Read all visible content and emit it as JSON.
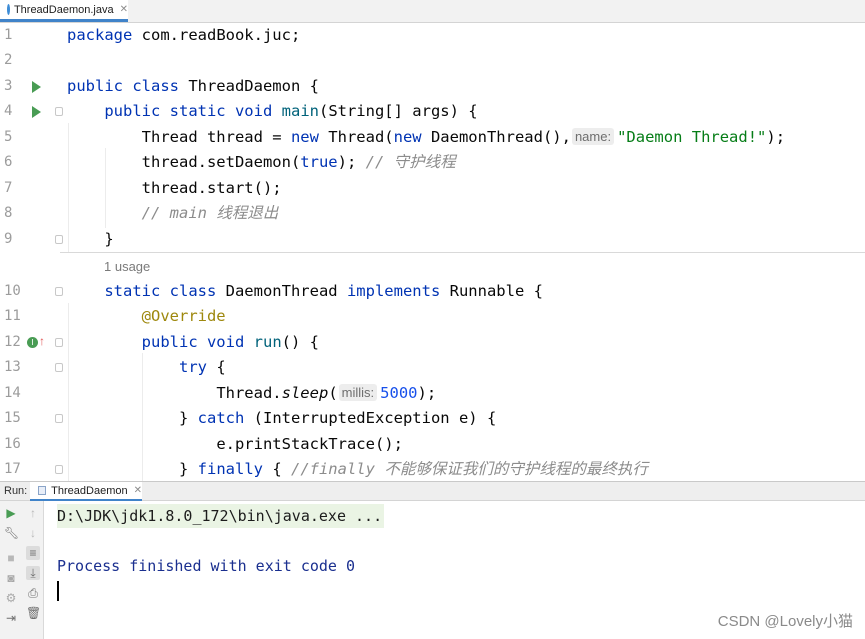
{
  "editor": {
    "tab": {
      "label": "ThreadDaemon.java",
      "close_icon": "close-icon",
      "file_icon": "java-class-icon"
    },
    "lines": [
      {
        "num": "1"
      },
      {
        "num": "2"
      },
      {
        "num": "3"
      },
      {
        "num": "4"
      },
      {
        "num": "5"
      },
      {
        "num": "6"
      },
      {
        "num": "7"
      },
      {
        "num": "8"
      },
      {
        "num": "9"
      },
      {
        "num": "10"
      },
      {
        "num": "11"
      },
      {
        "num": "12"
      },
      {
        "num": "13"
      },
      {
        "num": "14"
      },
      {
        "num": "15"
      },
      {
        "num": "16"
      },
      {
        "num": "17"
      }
    ],
    "code": {
      "l1_kw": "package",
      "l1_rest": " com.readBook.juc;",
      "l3_kw": "public class",
      "l3_rest": " ThreadDaemon {",
      "l4_kw": "public static void",
      "l4_fn": "main",
      "l4_rest": "(String[] args) {",
      "l5_a": "Thread thread = ",
      "l5_kw1": "new",
      "l5_b": " Thread(",
      "l5_kw2": "new",
      "l5_c": " DaemonThread(),",
      "l5_hint": "name:",
      "l5_str": "\"Daemon Thread!\"",
      "l5_d": ");",
      "l6_a": "thread.setDaemon(",
      "l6_kw": "true",
      "l6_b": "); ",
      "l6_cmt": "// 守护线程",
      "l7": "thread.start();",
      "l8_cmt": "// main 线程退出",
      "l9": "}",
      "usage": "1 usage",
      "l10_kw1": "static class",
      "l10_a": " DaemonThread ",
      "l10_kw2": "implements",
      "l10_b": " Runnable {",
      "l11_ann": "@Override",
      "l12_kw": "public void",
      "l12_fn": "run",
      "l12_rest": "() {",
      "l13_kw": "try",
      "l13_rest": " {",
      "l14_a": "Thread.",
      "l14_it": "sleep",
      "l14_b": "(",
      "l14_hint": "millis:",
      "l14_num": "5000",
      "l14_c": ");",
      "l15_a": "} ",
      "l15_kw": "catch",
      "l15_b": " (InterruptedException e) {",
      "l16": "e.printStackTrace();",
      "l17_a": "} ",
      "l17_kw": "finally",
      "l17_b": " { ",
      "l17_cmt_it": "//finally",
      "l17_cmt": " 不能够保证我们的守护线程的最终执行"
    }
  },
  "run_panel": {
    "label": "Run:",
    "tab_label": "ThreadDaemon",
    "console": {
      "command": "D:\\JDK\\jdk1.8.0_172\\bin\\java.exe ...",
      "exit_message": "Process finished with exit code 0"
    }
  },
  "watermark": "CSDN @Lovely小猫",
  "colors": {
    "keyword": "#0033b3",
    "string": "#067d17",
    "number": "#1750eb",
    "comment": "#8c8c8c",
    "annotation": "#9e880d",
    "accent": "#4083c9",
    "run_green": "#499c54"
  }
}
